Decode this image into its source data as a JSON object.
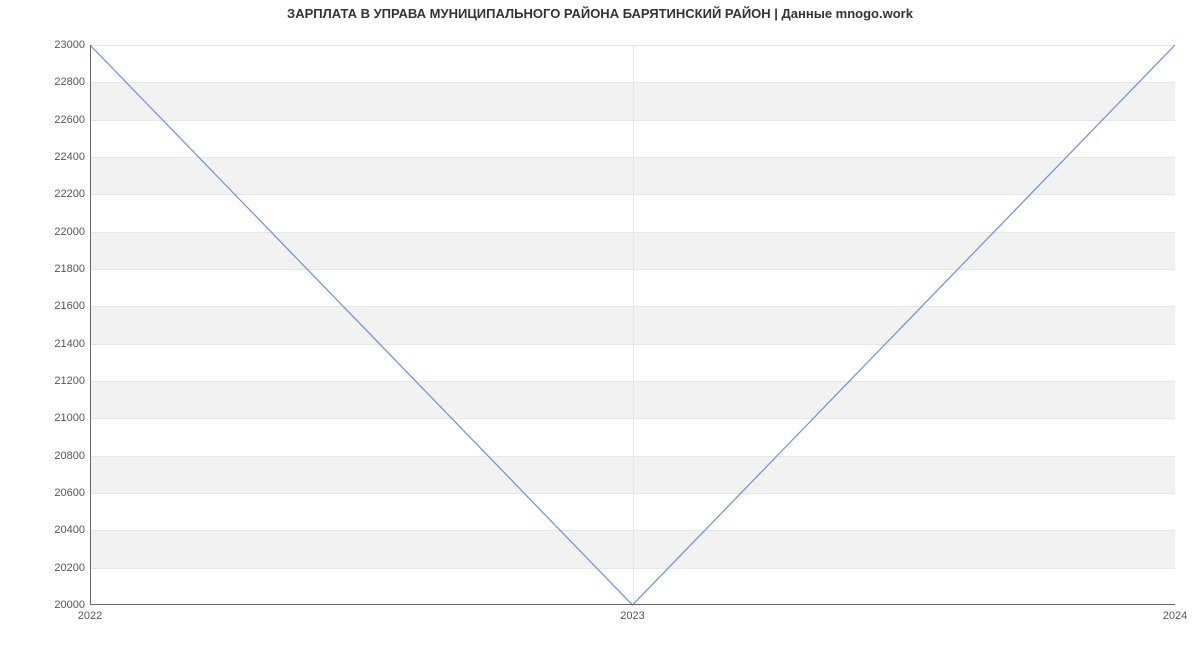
{
  "chart_data": {
    "type": "line",
    "title": "ЗАРПЛАТА В УПРАВА МУНИЦИПАЛЬНОГО РАЙОНА БАРЯТИНСКИЙ РАЙОН | Данные mnogo.work",
    "xlabel": "",
    "ylabel": "",
    "x": [
      "2022",
      "2023",
      "2024"
    ],
    "values": [
      23000,
      20000,
      23000
    ],
    "ylim": [
      20000,
      23000
    ],
    "yticks": [
      20000,
      20200,
      20400,
      20600,
      20800,
      21000,
      21200,
      21400,
      21600,
      21800,
      22000,
      22200,
      22400,
      22600,
      22800,
      23000
    ]
  }
}
